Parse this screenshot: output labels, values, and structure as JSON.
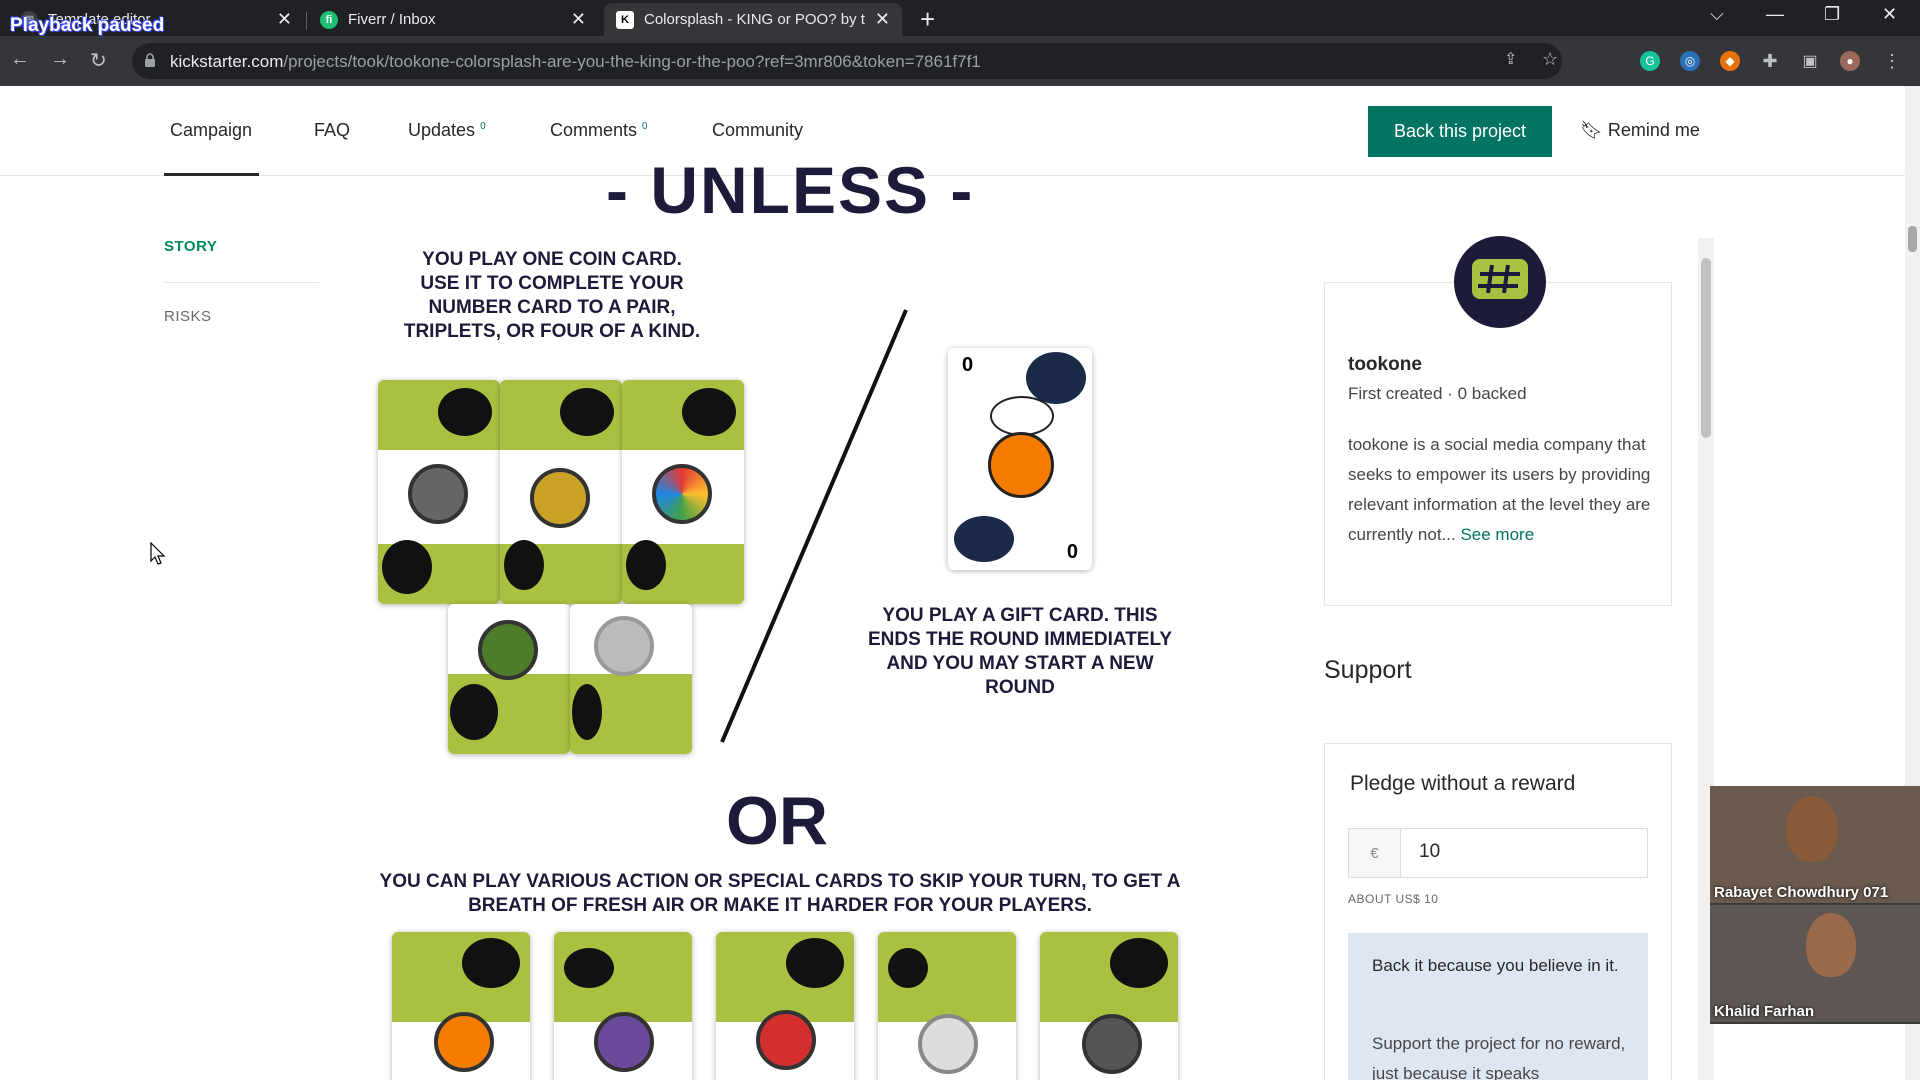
{
  "browser": {
    "tabs": [
      {
        "title": "Template editor",
        "icon": "template-icon"
      },
      {
        "title": "Fiverr / Inbox",
        "icon": "fiverr-icon"
      },
      {
        "title": "Colorsplash - KING or POO? by t",
        "icon": "kickstarter-icon"
      }
    ],
    "overlay_text": "Playback paused",
    "url_domain": "kickstarter.com",
    "url_path": "/projects/took/tookone-colorsplash-are-you-the-king-or-the-poo?ref=3mr806&token=7861f7f1"
  },
  "campaign_nav": {
    "items": [
      "Campaign",
      "FAQ",
      "Updates",
      "Comments",
      "Community"
    ],
    "updates_count": "0",
    "comments_count": "0",
    "back_button": "Back this project",
    "remind": "Remind me"
  },
  "story_nav": {
    "story": "STORY",
    "risks": "RISKS"
  },
  "story": {
    "unless": "- UNLESS -",
    "coin_text": "YOU PLAY ONE COIN CARD. USE IT TO COMPLETE YOUR NUMBER CARD TO A PAIR, TRIPLETS, OR FOUR OF A KIND.",
    "gift_text": "YOU PLAY A GIFT CARD. THIS ENDS THE ROUND IMMEDIATELY AND YOU MAY START A NEW ROUND",
    "or": "OR",
    "various_text": "YOU CAN PLAY VARIOUS ACTION OR SPECIAL CARDS TO SKIP YOUR TURN, TO GET A BREATH OF FRESH AIR OR MAKE IT HARDER FOR YOUR PLAYERS.",
    "card_corner_value": "0"
  },
  "creator": {
    "name": "tookone",
    "meta": "First created · 0 backed",
    "bio": "tookone is a social media company that seeks to empower its users by providing relevant information at the level they are currently not...",
    "see_more": "See more"
  },
  "support": {
    "heading": "Support",
    "pledge_title": "Pledge without a reward",
    "currency": "€",
    "amount": "10",
    "about": "ABOUT US$ 10",
    "believe_title": "Back it because you believe in it.",
    "believe_body": "Support the project for no reward, just because it speaks"
  },
  "video_call": {
    "participants": [
      "Rabayet Chowdhury 071",
      "Khalid Farhan"
    ]
  }
}
